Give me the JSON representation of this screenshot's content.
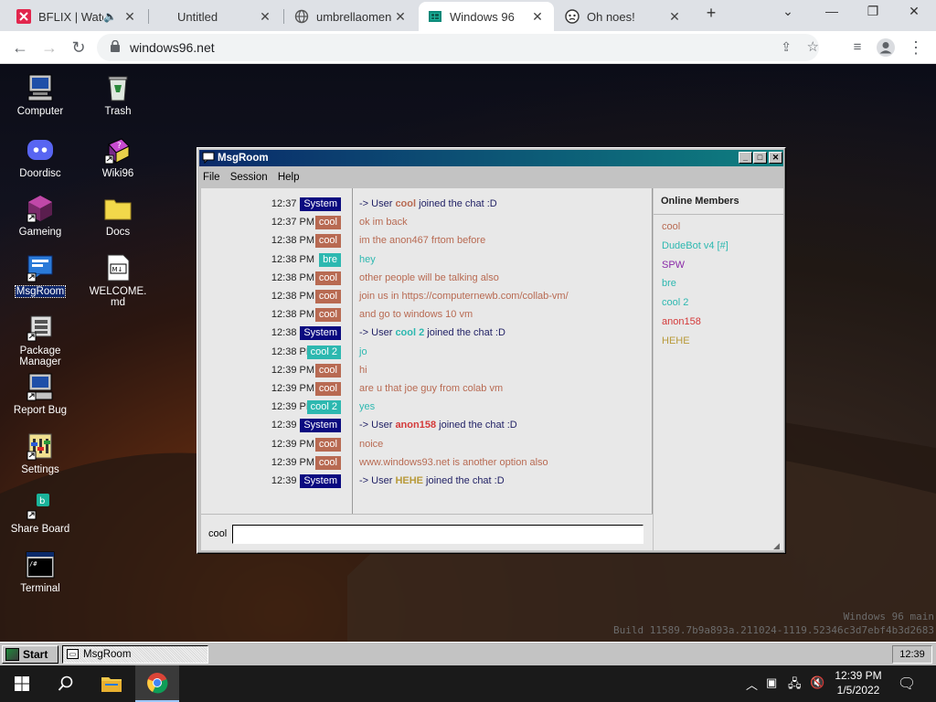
{
  "browser": {
    "tabs": [
      {
        "title": "BFLIX | Watc",
        "icon": "bflix-favicon",
        "audio": "🔈"
      },
      {
        "title": "Untitled",
        "icon": ""
      },
      {
        "title": "umbrellaomend",
        "icon": "globe-icon"
      },
      {
        "title": "Windows 96",
        "icon": "windows96-favicon"
      },
      {
        "title": "Oh noes!",
        "icon": "alert-favicon"
      }
    ],
    "active_tab": 3,
    "url": "windows96.net",
    "new_tab": "+",
    "close_glyph": "✕"
  },
  "desktop": {
    "icons": [
      {
        "label": "Computer"
      },
      {
        "label": "Trash"
      },
      {
        "label": "Doordisc"
      },
      {
        "label": "Wiki96"
      },
      {
        "label": "Gameing"
      },
      {
        "label": "Docs"
      },
      {
        "label": "MsgRoom"
      },
      {
        "label": "WELCOME.md"
      },
      {
        "label": "Package Manager"
      },
      {
        "label": "Report Bug"
      },
      {
        "label": "Settings"
      },
      {
        "label": "Share Board"
      },
      {
        "label": "Terminal"
      }
    ],
    "watermark_line1": "Windows 96 main",
    "watermark_line2": "Build 11589.7b9a893a.211024-1119.52346c3d7ebf4b3d2683"
  },
  "window": {
    "title": "MsgRoom",
    "menu": [
      "File",
      "Session",
      "Help"
    ],
    "messages": [
      {
        "time": "12:37 PM",
        "name": "System",
        "color": "#0a0a80",
        "parts": [
          [
            "-> User ",
            "#222266"
          ],
          [
            "cool",
            "#b86a52"
          ],
          [
            " joined the chat :D",
            "#222266"
          ]
        ]
      },
      {
        "time": "12:37 PM",
        "name": "cool",
        "color": "#b86a52",
        "parts": [
          [
            "ok im back",
            "#b86a52"
          ]
        ]
      },
      {
        "time": "12:38 PM",
        "name": "cool",
        "color": "#b86a52",
        "parts": [
          [
            "im the anon467 frtom before",
            "#b86a52"
          ]
        ]
      },
      {
        "time": "12:38 PM",
        "name": "bre",
        "color": "#2db8b0",
        "parts": [
          [
            "hey",
            "#2db8b0"
          ]
        ]
      },
      {
        "time": "12:38 PM",
        "name": "cool",
        "color": "#b86a52",
        "parts": [
          [
            "other people will be talking also",
            "#b86a52"
          ]
        ]
      },
      {
        "time": "12:38 PM",
        "name": "cool",
        "color": "#b86a52",
        "parts": [
          [
            "join us in https://computernewb.com/collab-vm/",
            "#b86a52"
          ]
        ]
      },
      {
        "time": "12:38 PM",
        "name": "cool",
        "color": "#b86a52",
        "parts": [
          [
            "and go to windows 10 vm",
            "#b86a52"
          ]
        ]
      },
      {
        "time": "12:38 PM",
        "name": "System",
        "color": "#0a0a80",
        "parts": [
          [
            "-> User ",
            "#222266"
          ],
          [
            "cool 2",
            "#2db8b0"
          ],
          [
            " joined the chat :D",
            "#222266"
          ]
        ]
      },
      {
        "time": "12:38 PM",
        "name": "cool 2",
        "color": "#2db8b0",
        "parts": [
          [
            "jo",
            "#2db8b0"
          ]
        ]
      },
      {
        "time": "12:39 PM",
        "name": "cool",
        "color": "#b86a52",
        "parts": [
          [
            "hi",
            "#b86a52"
          ]
        ]
      },
      {
        "time": "12:39 PM",
        "name": "cool",
        "color": "#b86a52",
        "parts": [
          [
            "are u that joe guy from colab vm",
            "#b86a52"
          ]
        ]
      },
      {
        "time": "12:39 PM",
        "name": "cool 2",
        "color": "#2db8b0",
        "parts": [
          [
            "yes",
            "#2db8b0"
          ]
        ]
      },
      {
        "time": "12:39 PM",
        "name": "System",
        "color": "#0a0a80",
        "parts": [
          [
            "-> User ",
            "#222266"
          ],
          [
            "anon158",
            "#d43a3a"
          ],
          [
            " joined the chat :D",
            "#222266"
          ]
        ]
      },
      {
        "time": "12:39 PM",
        "name": "cool",
        "color": "#b86a52",
        "parts": [
          [
            "noice",
            "#b86a52"
          ]
        ]
      },
      {
        "time": "12:39 PM",
        "name": "cool",
        "color": "#b86a52",
        "parts": [
          [
            "www.windows93.net is another option also",
            "#b86a52"
          ]
        ]
      },
      {
        "time": "12:39 PM",
        "name": "System",
        "color": "#0a0a80",
        "parts": [
          [
            "-> User ",
            "#222266"
          ],
          [
            "HEHE",
            "#b89a3a"
          ],
          [
            " joined the chat :D",
            "#222266"
          ]
        ]
      }
    ],
    "members_title": "Online Members",
    "members": [
      {
        "name": "cool",
        "color": "#b86a52"
      },
      {
        "name": "DudeBot v4 [#]",
        "color": "#2db8b0"
      },
      {
        "name": "SPW",
        "color": "#8a2aa8"
      },
      {
        "name": "bre",
        "color": "#2db8b0"
      },
      {
        "name": "cool 2",
        "color": "#2db8b0"
      },
      {
        "name": "anon158",
        "color": "#d43a3a"
      },
      {
        "name": "HEHE",
        "color": "#b89a3a"
      }
    ],
    "nick": "cool",
    "input_value": ""
  },
  "w96taskbar": {
    "start": "Start",
    "task": "MsgRoom",
    "clock": "12:39"
  },
  "wintaskbar": {
    "time": "12:39 PM",
    "date": "1/5/2022"
  }
}
